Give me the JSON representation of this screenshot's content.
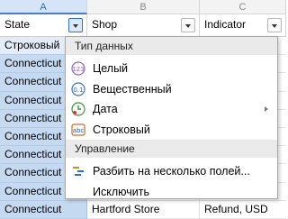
{
  "columns": [
    {
      "letter": "A",
      "header": "State",
      "active": true
    },
    {
      "letter": "B",
      "header": "Shop"
    },
    {
      "letter": "C",
      "header": "Indicator"
    }
  ],
  "rows": [
    {
      "a": "Строковый",
      "b": "",
      "c": ""
    },
    {
      "a": "Connecticut",
      "b": "",
      "c": ""
    },
    {
      "a": "Connecticut",
      "b": "",
      "c": ""
    },
    {
      "a": "Connecticut",
      "b": "",
      "c": ""
    },
    {
      "a": "Connecticut",
      "b": "",
      "c": ""
    },
    {
      "a": "Connecticut",
      "b": "",
      "c": ""
    },
    {
      "a": "Connecticut",
      "b": "",
      "c": ""
    },
    {
      "a": "Connecticut",
      "b": "",
      "c": ""
    },
    {
      "a": "Connecticut",
      "b": "",
      "c": ""
    },
    {
      "a": "Connecticut",
      "b": "Hartford Store",
      "c": "Refund, USD"
    }
  ],
  "menu": {
    "data_type_section": "Тип данных",
    "items": [
      {
        "label": "Целый",
        "icon": "integer-type-icon"
      },
      {
        "label": "Вещественный",
        "icon": "real-type-icon"
      },
      {
        "label": "Дата",
        "icon": "date-type-icon",
        "submenu": true
      },
      {
        "label": "Строковый",
        "icon": "string-type-icon"
      }
    ],
    "manage_section": "Управление",
    "manage_items": [
      {
        "label": "Разбить на несколько полей...",
        "icon": "split-fields-icon"
      },
      {
        "label": "Исключить",
        "icon": ""
      }
    ]
  },
  "colors": {
    "selected_column": "#c5d9f1",
    "accent": "#4a7fcf",
    "menu_section_bg": "#eaeaea"
  }
}
